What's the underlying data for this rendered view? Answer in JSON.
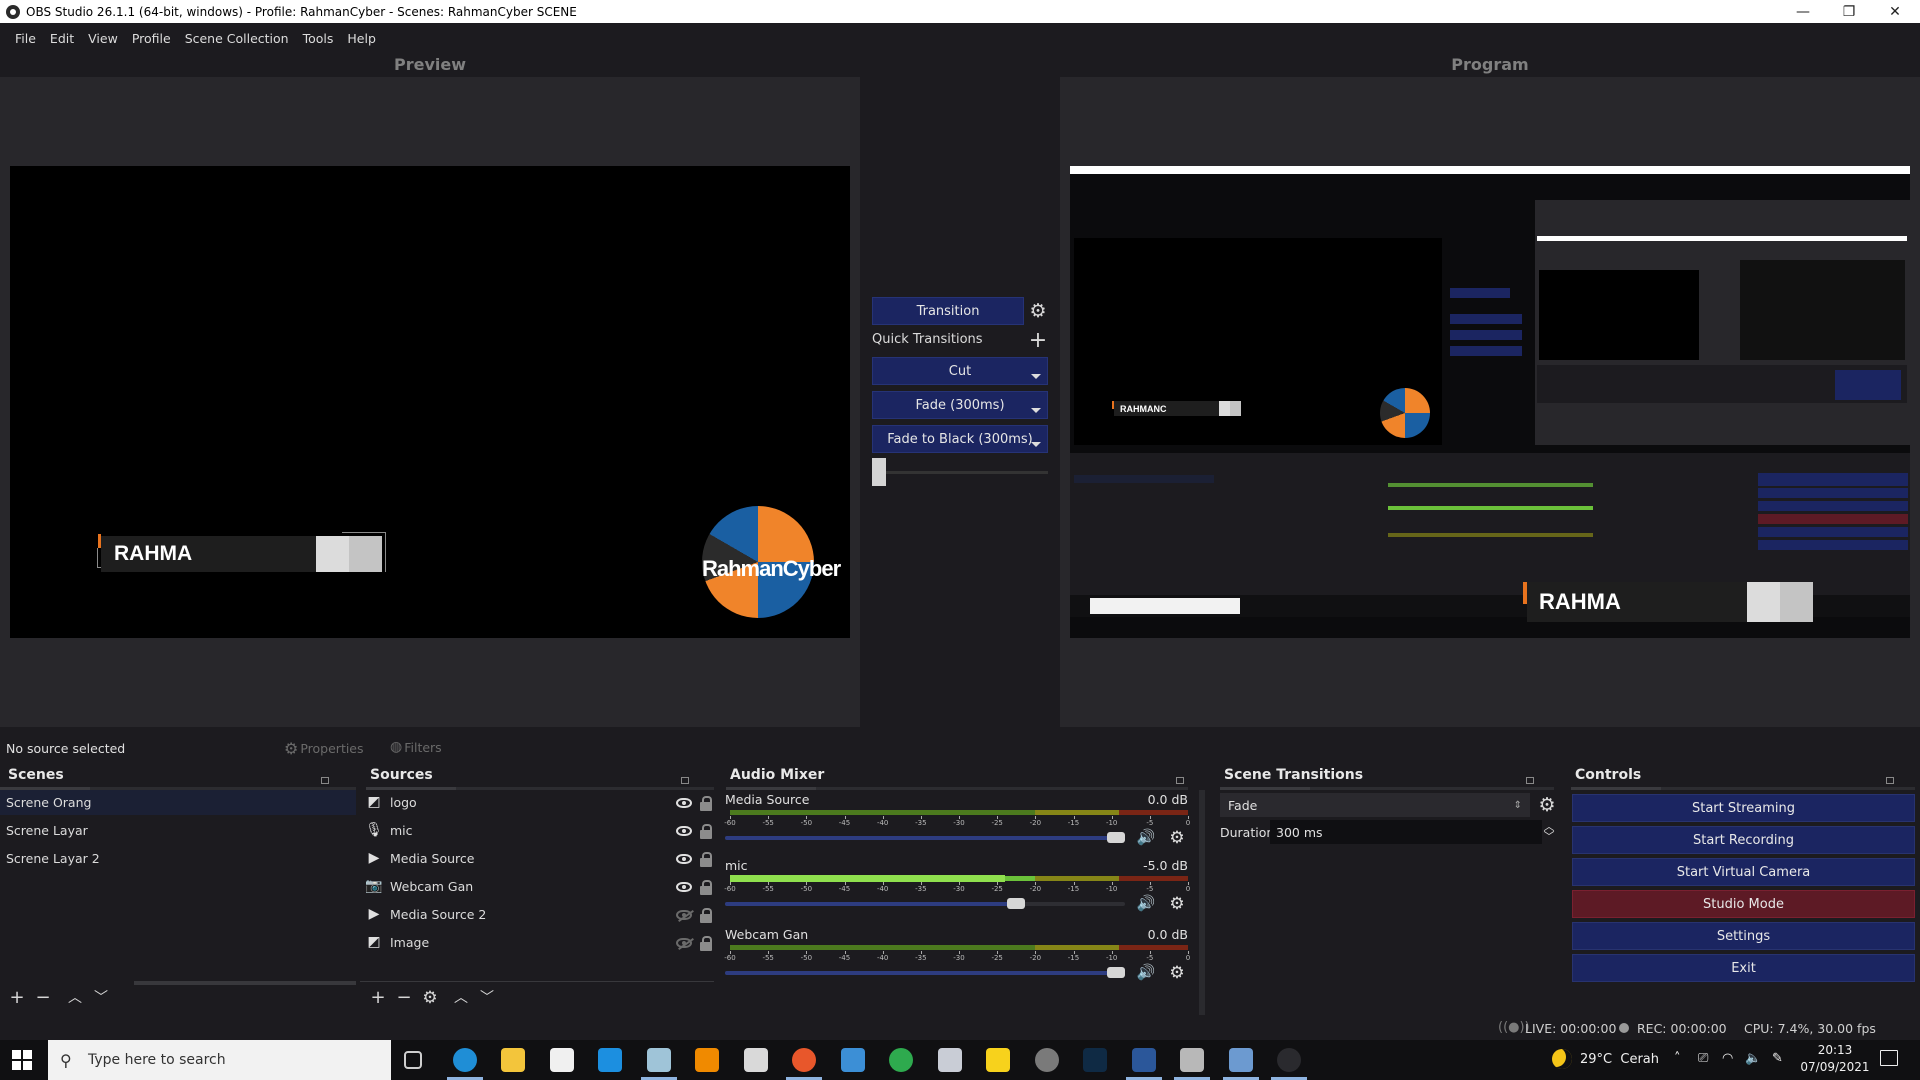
{
  "window": {
    "title": "OBS Studio 26.1.1 (64-bit, windows) - Profile: RahmanCyber - Scenes: RahmanCyber SCENE",
    "controls": {
      "minimize": "—",
      "restore": "❐",
      "close": "✕"
    }
  },
  "menu": [
    "File",
    "Edit",
    "View",
    "Profile",
    "Scene Collection",
    "Tools",
    "Help"
  ],
  "preview": {
    "label": "Preview",
    "lower_third_text": "RAHMA",
    "logo_text": "RahmanCyber"
  },
  "program": {
    "label": "Program",
    "nested_lower_third": "RAHMANC",
    "overlay_lower_third": "RAHMA"
  },
  "transition_panel": {
    "transition_button": "Transition",
    "quick_transitions_label": "Quick Transitions",
    "quick_transitions": [
      "Cut",
      "Fade (300ms)",
      "Fade to Black (300ms)"
    ],
    "tbar_position": 0
  },
  "source_toolbar": {
    "status": "No source selected",
    "properties": "Properties",
    "filters": "Filters"
  },
  "scenes": {
    "title": "Scenes",
    "items": [
      "Screne Orang",
      "Screne Layar",
      "Screne Layar 2"
    ],
    "selected_index": 0
  },
  "sources": {
    "title": "Sources",
    "items": [
      {
        "name": "logo",
        "type": "image",
        "visible": true,
        "locked": false
      },
      {
        "name": "mic",
        "type": "audio-input",
        "visible": true,
        "locked": false
      },
      {
        "name": "Media Source",
        "type": "media",
        "visible": true,
        "locked": false
      },
      {
        "name": "Webcam Gan",
        "type": "camera",
        "visible": true,
        "locked": false
      },
      {
        "name": "Media Source 2",
        "type": "media",
        "visible": false,
        "locked": false
      },
      {
        "name": "Image",
        "type": "image",
        "visible": false,
        "locked": false
      }
    ]
  },
  "audio_mixer": {
    "title": "Audio Mixer",
    "scale": [
      "-60",
      "-55",
      "-50",
      "-45",
      "-40",
      "-35",
      "-30",
      "-25",
      "-20",
      "-15",
      "-10",
      "-5",
      "0"
    ],
    "channels": [
      {
        "name": "Media Source",
        "db": "0.0 dB",
        "volume_fraction": 1.0,
        "level_db": null
      },
      {
        "name": "mic",
        "db": "-5.0 dB",
        "volume_fraction": 0.75,
        "level_db": -24
      },
      {
        "name": "Webcam Gan",
        "db": "0.0 dB",
        "volume_fraction": 1.0,
        "level_db": null
      }
    ]
  },
  "scene_transitions": {
    "title": "Scene Transitions",
    "selected": "Fade",
    "duration_label": "Duration",
    "duration_value": "300 ms"
  },
  "controls": {
    "title": "Controls",
    "buttons": [
      "Start Streaming",
      "Start Recording",
      "Start Virtual Camera",
      "Studio Mode",
      "Settings",
      "Exit"
    ]
  },
  "status_bar": {
    "live": "LIVE: 00:00:00",
    "rec": "REC: 00:00:00",
    "cpu": "CPU: 7.4%, 30.00 fps"
  },
  "taskbar": {
    "search_placeholder": "Type here to search",
    "apps": [
      "task-view",
      "edge",
      "file-explorer",
      "microsoft-store",
      "mail",
      "notepad",
      "vlc",
      "media-player-classic",
      "firefox",
      "windows-media-player",
      "chrome",
      "snipping-tool",
      "sticky-notes",
      "chrome-dev",
      "photoshop",
      "word",
      "sound-recorder",
      "calculator",
      "obs-studio"
    ],
    "weather": "29°C  Cerah",
    "time": "20:13",
    "date": "07/09/2021"
  },
  "colors": {
    "button_blue": "#1b2561",
    "studio_mode_red": "#5d1a25",
    "background": "#1c1b1f",
    "accent_orange": "#e8731e"
  }
}
